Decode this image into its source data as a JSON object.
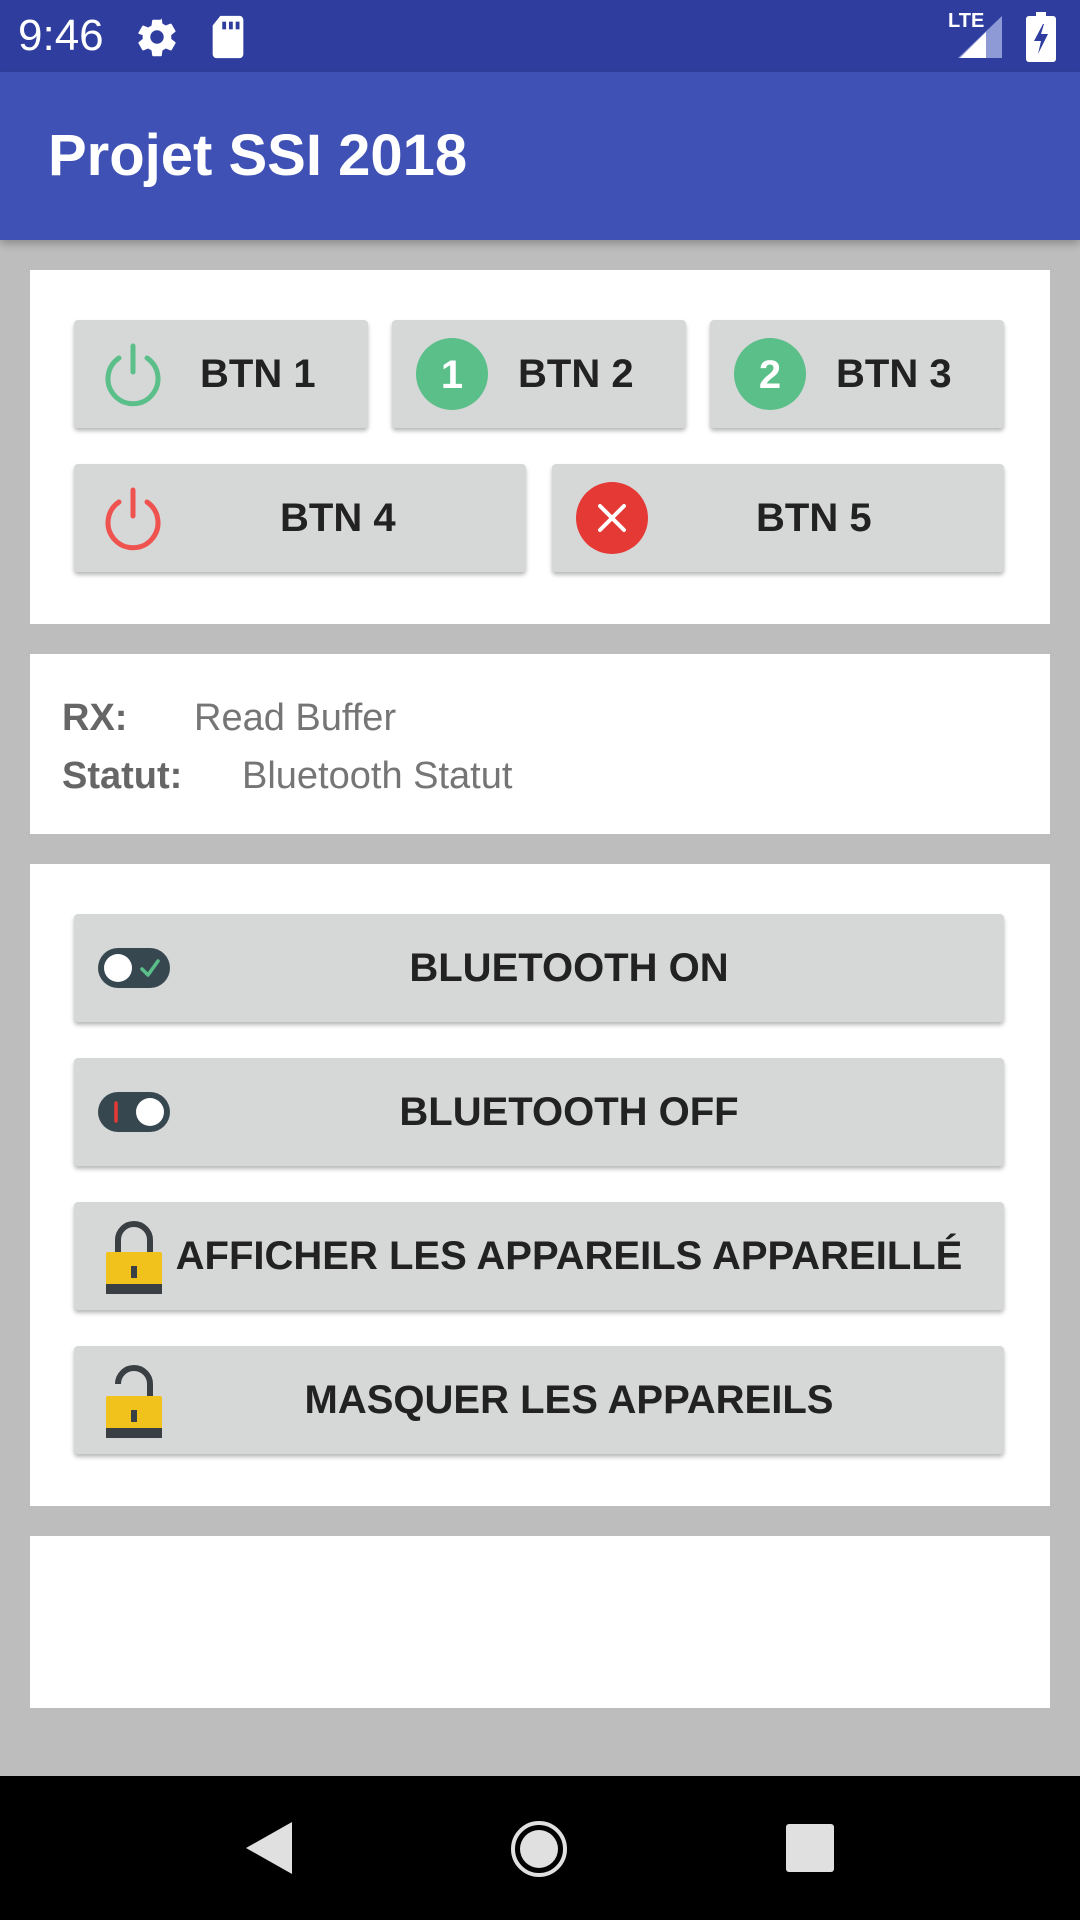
{
  "status_bar": {
    "time": "9:46",
    "network_label": "LTE"
  },
  "app_bar": {
    "title": "Projet SSI 2018",
    "color": "#3f51b5"
  },
  "buttons_card": {
    "btn1": {
      "label": "BTN 1",
      "icon": "power-icon-green"
    },
    "btn2": {
      "label": "BTN 2",
      "icon": "number-1-badge",
      "badge": "1"
    },
    "btn3": {
      "label": "BTN 3",
      "icon": "number-2-badge",
      "badge": "2"
    },
    "btn4": {
      "label": "BTN 4",
      "icon": "power-icon-red"
    },
    "btn5": {
      "label": "BTN 5",
      "icon": "close-circle-icon"
    }
  },
  "info_card": {
    "rx": {
      "key": "RX:",
      "value": "Read Buffer"
    },
    "statut": {
      "key": "Statut:",
      "value": "Bluetooth Statut"
    }
  },
  "bluetooth_card": {
    "on": {
      "label": "BLUETOOTH ON",
      "icon": "toggle-on-icon"
    },
    "off": {
      "label": "BLUETOOTH OFF",
      "icon": "toggle-off-icon"
    },
    "show_paired": {
      "label": "AFFICHER LES APPAREILS APPAREILLÉ",
      "icon": "lock-icon"
    },
    "hide_devices": {
      "label": "MASQUER LES APPAREILS",
      "icon": "unlock-icon"
    }
  },
  "colors": {
    "status_bar": "#2f3e9e",
    "accent_green": "#5bbf8a",
    "accent_red": "#e53935",
    "lock_yellow": "#f2c21c"
  }
}
